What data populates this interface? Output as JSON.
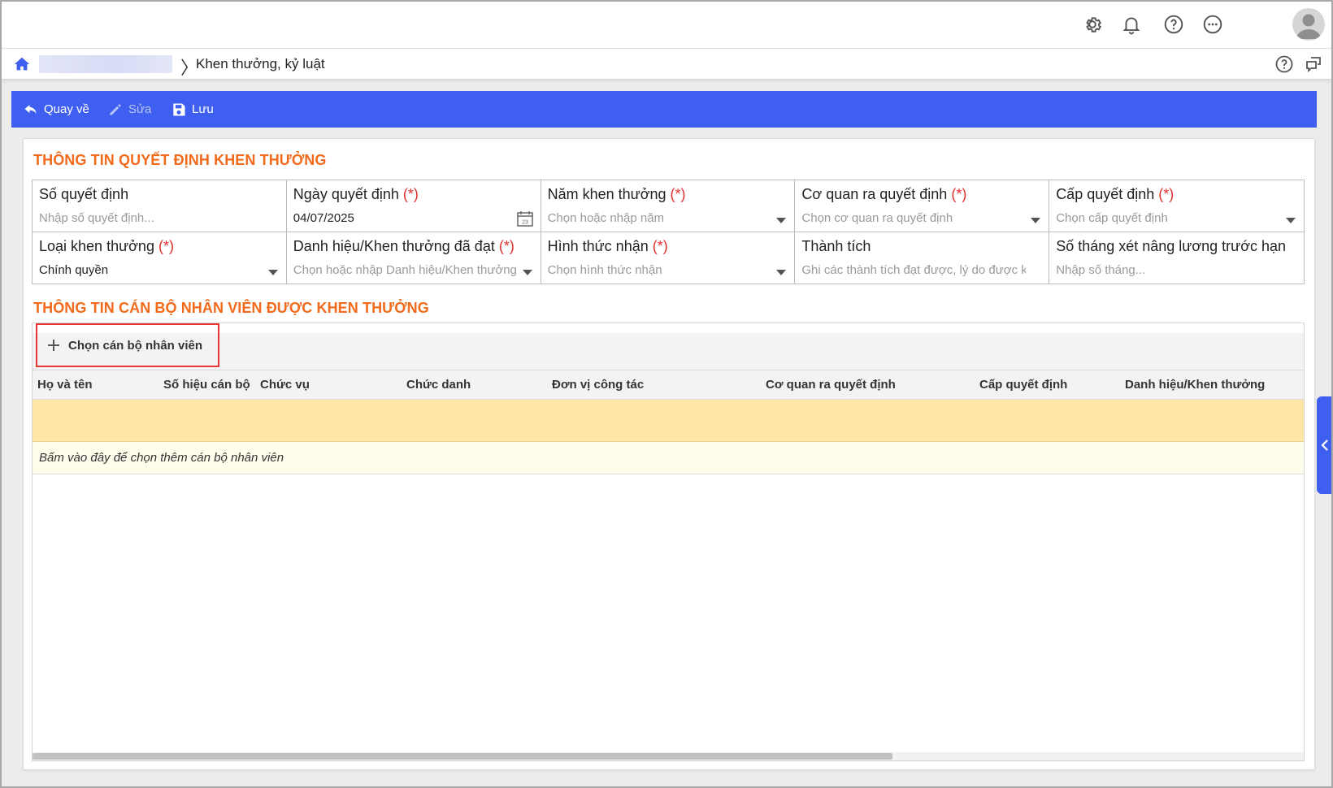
{
  "header": {
    "icons": [
      "gear-icon",
      "bell-icon",
      "help-icon",
      "more-icon",
      "avatar-icon"
    ]
  },
  "breadcrumb": {
    "separator": "〉",
    "current": "Khen thưởng, kỷ luật"
  },
  "toolbar": {
    "back_label": "Quay về",
    "edit_label": "Sửa",
    "save_label": "Lưu"
  },
  "decision": {
    "title": "THÔNG TIN QUYẾT ĐỊNH KHEN THƯỞNG",
    "required_mark": "(*)",
    "fields": [
      {
        "label": "Số quyết định",
        "required": false,
        "value": "",
        "placeholder": "Nhập số quyết định...",
        "control": "text"
      },
      {
        "label": "Ngày quyết định",
        "required": true,
        "value": "04/07/2025",
        "placeholder": "",
        "control": "date"
      },
      {
        "label": "Năm khen thưởng",
        "required": true,
        "value": "",
        "placeholder": "Chọn hoặc nhập năm",
        "control": "dropdown"
      },
      {
        "label": "Cơ quan ra quyết định",
        "required": true,
        "value": "",
        "placeholder": "Chọn cơ quan ra quyết định",
        "control": "dropdown"
      },
      {
        "label": "Cấp quyết định",
        "required": true,
        "value": "",
        "placeholder": "Chọn cấp quyết định",
        "control": "dropdown"
      },
      {
        "label": "Loại khen thưởng",
        "required": true,
        "value": "Chính quyền",
        "placeholder": "",
        "control": "dropdown"
      },
      {
        "label": "Danh hiệu/Khen thưởng đã đạt",
        "required": true,
        "value": "",
        "placeholder": "Chọn hoặc nhập Danh hiệu/Khen thưởng",
        "control": "dropdown"
      },
      {
        "label": "Hình thức nhận",
        "required": true,
        "value": "",
        "placeholder": "Chọn hình thức nhận",
        "control": "dropdown"
      },
      {
        "label": "Thành tích",
        "required": false,
        "value": "",
        "placeholder": "Ghi các thành tích đạt được, lý do được khen thưởng",
        "control": "text"
      },
      {
        "label": "Số tháng xét nâng lương trước hạn",
        "required": false,
        "value": "",
        "placeholder": "Nhập số tháng...",
        "control": "text"
      }
    ],
    "calendar_badge": "23"
  },
  "employees": {
    "title": "THÔNG TIN CÁN BỘ NHÂN VIÊN ĐƯỢC KHEN THƯỞNG",
    "select_button": "Chọn cán bộ nhân viên",
    "columns": [
      "Họ và tên",
      "Số hiệu cán bộ",
      "Chức vụ",
      "Chức danh",
      "Đơn vị công tác",
      "Cơ quan ra quyết định",
      "Cấp quyết định",
      "Danh hiệu/Khen thưởng"
    ],
    "rows": [],
    "hint": "Bấm vào đây để chọn thêm cán bộ nhân viên"
  },
  "colors": {
    "toolbar": "#3e5fef",
    "section_title": "#f26a1b",
    "required": "#e0312f",
    "selected_row": "#ffe5a6",
    "hint_row": "#fffdeb"
  }
}
